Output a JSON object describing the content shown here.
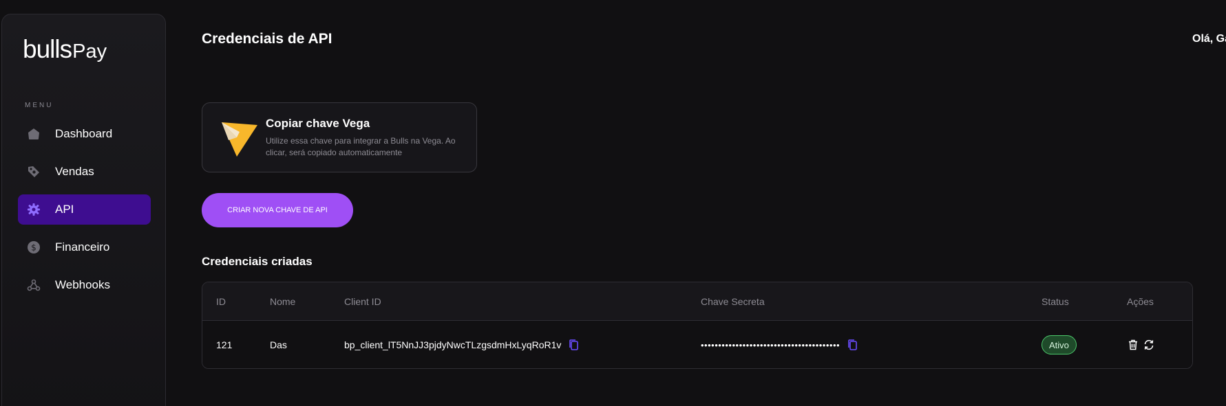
{
  "brand": {
    "logo_part1": "bulls",
    "logo_part2": "Pay"
  },
  "sidebar": {
    "menu_label": "MENU",
    "items": [
      {
        "label": "Dashboard",
        "icon": "home-icon",
        "active": false
      },
      {
        "label": "Vendas",
        "icon": "tag-icon",
        "active": false
      },
      {
        "label": "API",
        "icon": "gear-icon",
        "active": true
      },
      {
        "label": "Financeiro",
        "icon": "dollar-icon",
        "active": false
      },
      {
        "label": "Webhooks",
        "icon": "webhook-icon",
        "active": false
      }
    ]
  },
  "header": {
    "title": "Credenciais de API",
    "greeting": "Olá, Ga"
  },
  "vega_card": {
    "title": "Copiar chave Vega",
    "description": "Utilize essa chave para integrar a Bulls na Vega. Ao clicar, será copiado automaticamente",
    "icon": "vega-logo-icon"
  },
  "create_button": {
    "label": "CRIAR NOVA CHAVE DE API"
  },
  "credentials": {
    "section_title": "Credenciais criadas",
    "columns": [
      "ID",
      "Nome",
      "Client ID",
      "Chave Secreta",
      "Status",
      "Ações"
    ],
    "rows": [
      {
        "id": "121",
        "name": "Das",
        "client_id": "bp_client_lT5NnJJ3pjdyNwcTLzgsdmHxLyqRoR1v",
        "secret": "••••••••••••••••••••••••••••••••••••••••",
        "status": "Ativo"
      }
    ]
  },
  "colors": {
    "background": "#111012",
    "accent": "#9f4ff5",
    "active_nav": "#3e0d90",
    "status_green": "#4cc86b"
  }
}
